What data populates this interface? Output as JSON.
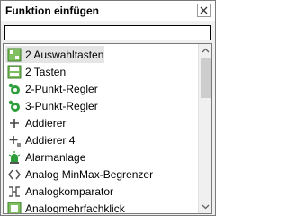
{
  "window": {
    "title": "Funktion einfügen"
  },
  "search": {
    "value": ""
  },
  "list": {
    "items": [
      {
        "label": "2 Auswahltasten",
        "icon": "two-select-buttons-icon"
      },
      {
        "label": "2 Tasten",
        "icon": "two-buttons-icon"
      },
      {
        "label": "2-Punkt-Regler",
        "icon": "two-point-controller-icon"
      },
      {
        "label": "3-Punkt-Regler",
        "icon": "three-point-controller-icon"
      },
      {
        "label": "Addierer",
        "icon": "plus-icon"
      },
      {
        "label": "Addierer 4",
        "icon": "plus-four-icon"
      },
      {
        "label": "Alarmanlage",
        "icon": "alarm-icon"
      },
      {
        "label": "Analog MinMax-Begrenzer",
        "icon": "minmax-limiter-icon"
      },
      {
        "label": "Analogkomparator",
        "icon": "comparator-icon"
      },
      {
        "label": "Analogmehrfachklick",
        "icon": "multi-click-icon"
      }
    ]
  },
  "colors": {
    "accent_green": "#2e9e3a",
    "selection": "#e5e5e5"
  }
}
